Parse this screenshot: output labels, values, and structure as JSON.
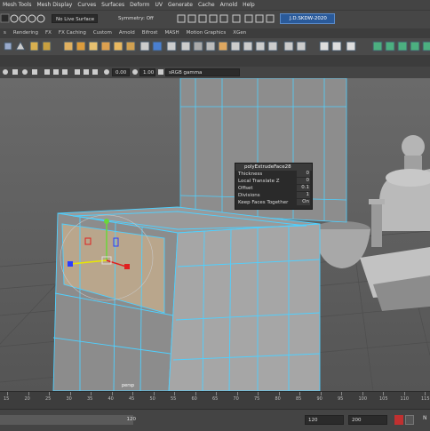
{
  "menubar": {
    "items": [
      "Mesh Tools",
      "Mesh Display",
      "Curves",
      "Surfaces",
      "Deform",
      "UV",
      "Generate",
      "Cache",
      "Arnold",
      "Help"
    ]
  },
  "statusline": {
    "live_surface": "No Live Surface",
    "symmetry": "Symmetry: Off",
    "workspace": "J.D.SKDW-2020"
  },
  "shelf_tabs": [
    "s",
    "Rendering",
    "FX",
    "FX Caching",
    "Custom",
    "Arnold",
    "Bifrost",
    "MASH",
    "Motion Graphics",
    "XGen"
  ],
  "panel_toolbar": {
    "exposure": "0.00",
    "gamma": "1.00",
    "color_space": "sRGB gamma"
  },
  "hud": {
    "title": "polyExtrudeFace28",
    "rows": [
      {
        "label": "Thickness",
        "value": "0"
      },
      {
        "label": "Local Translate Z",
        "value": "0"
      },
      {
        "label": "Offset",
        "value": "0.1"
      },
      {
        "label": "Divisions",
        "value": "1"
      },
      {
        "label": "Keep Faces Together",
        "value": "On"
      }
    ]
  },
  "viewport": {
    "camera": "persp"
  },
  "timeslider": {
    "ticks": [
      "15",
      "20",
      "25",
      "30",
      "35",
      "40",
      "45",
      "50",
      "55",
      "60",
      "65",
      "70",
      "75",
      "80",
      "85",
      "90",
      "95",
      "100",
      "105",
      "110",
      "115"
    ]
  },
  "range": {
    "end_inner": "120",
    "end_outer": "120",
    "max": "200",
    "fps": "N"
  }
}
